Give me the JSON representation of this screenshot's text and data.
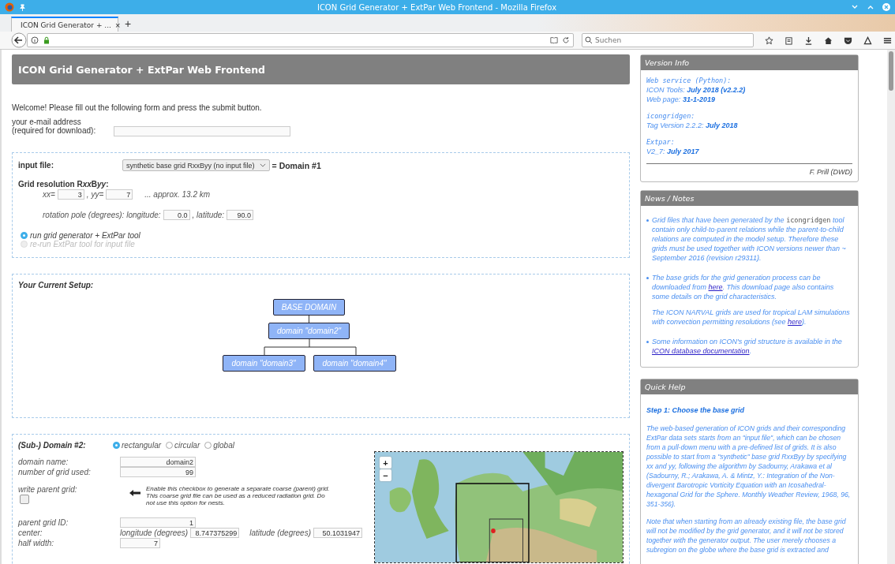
{
  "browser": {
    "window_title": "ICON Grid Generator + ExtPar Web Frontend - Mozilla Firefox",
    "tab_title": "ICON Grid Generator + ...",
    "tab_close": "×",
    "new_tab": "+",
    "search_placeholder": "Suchen"
  },
  "header": {
    "title": "ICON Grid Generator + ExtPar Web Frontend"
  },
  "welcome": "Welcome! Please fill out the following form and press the submit button.",
  "email": {
    "label": "your e-mail address",
    "hint": "(required for download):"
  },
  "input_file": {
    "label": "input file:",
    "select_value": "synthetic base grid RxxByy (no input file)",
    "domain_label": "= Domain #1"
  },
  "grid_resolution": {
    "heading": [
      {
        "text": "Grid resolution R",
        "italic": false
      },
      {
        "text": "xx",
        "italic": true
      },
      {
        "text": "B",
        "italic": false
      },
      {
        "text": "yy",
        "italic": true
      },
      {
        "text": ":",
        "italic": false
      }
    ],
    "xx_label": "xx=",
    "xx_value": "3",
    "yy_label": ", yy=",
    "yy_value": "7",
    "approx": "... approx. 13.2 km"
  },
  "rotation": {
    "label": "rotation pole (degrees): longitude:",
    "longitude": "0.0",
    "lat_label": ", latitude:",
    "latitude": "90.0"
  },
  "modes": [
    {
      "label": "run grid generator + ExtPar tool",
      "selected": true,
      "disabled": false
    },
    {
      "label": "re-run ExtPar tool for input file",
      "selected": false,
      "disabled": true
    }
  ],
  "setup": {
    "heading": "Your Current Setup:",
    "tree": {
      "label": "BASE DOMAIN",
      "children": [
        {
          "label": "domain \"domain2\"",
          "children": [
            {
              "label": "domain \"domain3\""
            },
            {
              "label": "domain \"domain4\""
            }
          ]
        }
      ]
    }
  },
  "domain": {
    "heading": "(Sub-) Domain #2:",
    "shapes": [
      {
        "label": "rectangular",
        "selected": true
      },
      {
        "label": "circular",
        "selected": false
      },
      {
        "label": "global",
        "selected": false
      }
    ],
    "name_label": "domain name:",
    "name_value": "domain2",
    "grid_label": "number of grid used:",
    "grid_value": "99",
    "parent_grid": {
      "label": "write parent grid:",
      "checked": false,
      "note": "Enable this checkbox to generate a separate coarse (parent) grid. This coarse grid file can be used as a reduced radiation grid. Do not use this option for nests."
    },
    "parent_id_label": "parent grid ID:",
    "parent_id_value": "1",
    "center_label": "center:",
    "lon_label": "longitude (degrees)",
    "lon_value": "8.747375299",
    "lat_label": "latitude (degrees)",
    "lat_value": "50.1031947",
    "half_width_label": "half width:",
    "half_width_value": "7"
  },
  "map": {
    "zoom_in": "+",
    "zoom_out": "−"
  },
  "version_info": {
    "title": "Version Info",
    "groups": [
      {
        "lines": [
          {
            "kind": "mono",
            "text": "Web service (Python):"
          },
          {
            "kind": "text",
            "text": "ICON Tools: **July 2018 (v2.2.2)**"
          },
          {
            "kind": "text",
            "text": "Web page: **31-1-2019**"
          }
        ]
      },
      {
        "lines": [
          {
            "kind": "mono",
            "text": "icongridgen:"
          },
          {
            "kind": "text",
            "text": "Tag Version 2.2.2: **July 2018**"
          }
        ]
      },
      {
        "lines": [
          {
            "kind": "mono",
            "text": "Extpar:"
          },
          {
            "kind": "text",
            "text": "V2_7: **July 2017**"
          }
        ]
      }
    ],
    "author": "F. Prill (DWD)"
  },
  "news": {
    "title": "News / Notes",
    "items": [
      {
        "paragraphs": [
          [
            {
              "kind": "text",
              "text": "Grid files that have been generated by the "
            },
            {
              "kind": "code",
              "text": "icongridgen"
            },
            {
              "kind": "text",
              "text": " tool contain only child-to-parent relations while the parent-to-child relations are computed in the model setup. Therefore these grids must be used together with ICON versions newer than ~ September 2016 (revision r29311)."
            }
          ]
        ]
      },
      {
        "paragraphs": [
          [
            {
              "kind": "text",
              "text": "The base grids for the grid generation process can be downloaded from "
            },
            {
              "kind": "link",
              "text": "here"
            },
            {
              "kind": "text",
              "text": ". This download page also contains some details on the grid characteristics."
            }
          ],
          [
            {
              "kind": "text",
              "text": "The ICON NARVAL grids are used for tropical LAM simulations with convection permitting resolutions (see "
            },
            {
              "kind": "link",
              "text": "here"
            },
            {
              "kind": "text",
              "text": ")."
            }
          ]
        ]
      },
      {
        "paragraphs": [
          [
            {
              "kind": "text",
              "text": "Some information on ICON's grid structure is available in the "
            },
            {
              "kind": "link",
              "text": "ICON database documentation"
            },
            {
              "kind": "text",
              "text": "."
            }
          ]
        ]
      }
    ]
  },
  "quick_help": {
    "title": "Quick Help",
    "step": "Step 1: Choose the base grid",
    "paragraphs": [
      "The web-based generation of ICON grids and their corresponding ExtPar data sets starts from an \"input file\", which can be chosen from a pull-down menu with a pre-defined list of grids. It is also possible to start from a \"synthetic\" base grid RxxByy by specifying xx and yy, following the algorithm by Sadourny, Arakawa et al (Sadourny, R.; Arakawa, A. & Mintz, Y.: Integration of the Non-divergent Barotropic Vorticity Equation with an Icosahedral-hexagonal Grid for the Sphere. Monthly Weather Review, 1968, 96, 351-356).",
      "Note that when starting from an already existing file, the base grid will not be modified by the grid generator, and it will not be stored together with the generator output. The user merely chooses a subregion on the globe where the base grid is extracted and"
    ]
  }
}
